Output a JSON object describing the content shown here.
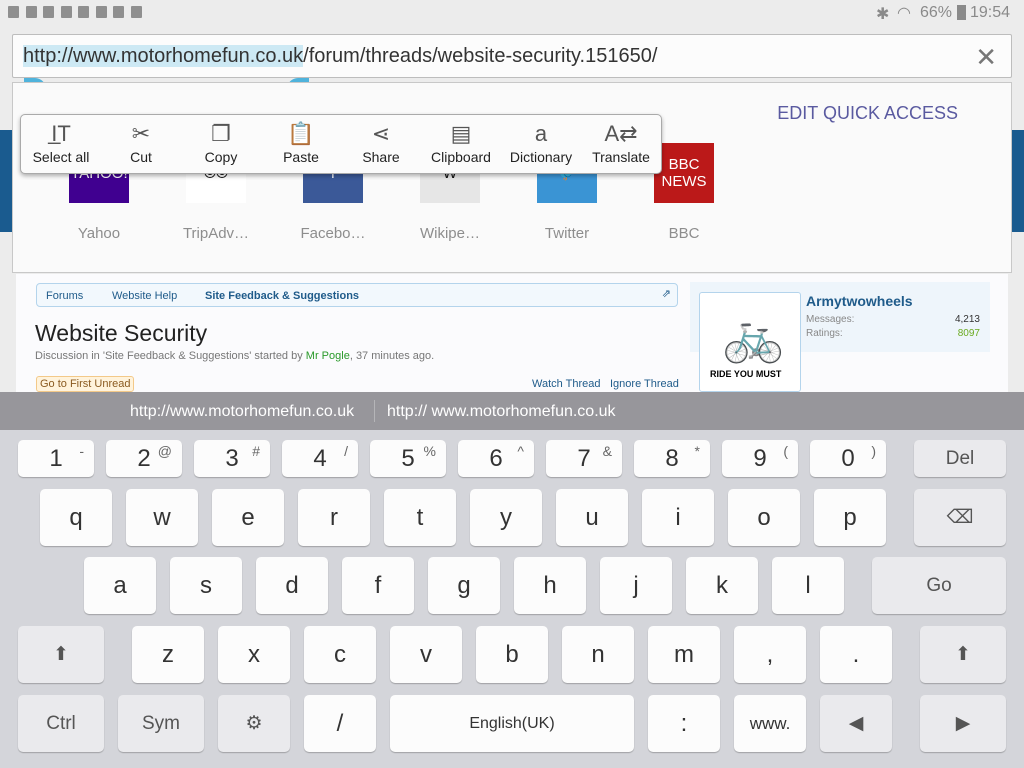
{
  "status": {
    "battery": "66%",
    "time": "19:54"
  },
  "urlbar": {
    "selected": "http://www.motorhomefun.co.uk",
    "rest": "/forum/threads/website-security.151650/"
  },
  "quick_access": {
    "edit": "EDIT QUICK ACCESS",
    "tiles": [
      {
        "label": "Yahoo",
        "color": "#400090",
        "glyph": "YAHOO!"
      },
      {
        "label": "TripAdv…",
        "color": "#ffffff",
        "glyph": "⦾⦾"
      },
      {
        "label": "Facebo…",
        "color": "#3b5998",
        "glyph": "f"
      },
      {
        "label": "Wikipe…",
        "color": "#e6e6e6",
        "glyph": "W"
      },
      {
        "label": "Twitter",
        "color": "#3a94d4",
        "glyph": "🐦"
      },
      {
        "label": "BBC",
        "color": "#bb1919",
        "glyph": "BBC NEWS"
      }
    ]
  },
  "context_menu": [
    {
      "label": "Select all",
      "icon": "select-all-icon",
      "glyph": "I̲T"
    },
    {
      "label": "Cut",
      "icon": "scissors-icon",
      "glyph": "✂"
    },
    {
      "label": "Copy",
      "icon": "copy-icon",
      "glyph": "❐"
    },
    {
      "label": "Paste",
      "icon": "paste-icon",
      "glyph": "📋"
    },
    {
      "label": "Share",
      "icon": "share-icon",
      "glyph": "⋖"
    },
    {
      "label": "Clipboard",
      "icon": "clipboard-icon",
      "glyph": "▤"
    },
    {
      "label": "Dictionary",
      "icon": "dictionary-icon",
      "glyph": "a"
    },
    {
      "label": "Translate",
      "icon": "translate-icon",
      "glyph": "A⇄"
    }
  ],
  "page": {
    "breadcrumbs": [
      "Forums",
      "Website Help",
      "Site Feedback & Suggestions"
    ],
    "title": "Website Security",
    "discussion_prefix": "Discussion in 'Site Feedback & Suggestions' started by ",
    "author": "Mr Pogle",
    "discussion_suffix": ", 37 minutes ago.",
    "first_unread": "Go to First Unread",
    "watch": "Watch Thread",
    "ignore": "Ignore Thread",
    "profile": {
      "name": "Armytwowheels",
      "messages_label": "Messages:",
      "messages": "4,213",
      "ratings_label": "Ratings:",
      "ratings": "8097",
      "avatar_caption": "RIDE YOU MUST"
    }
  },
  "suggestions": [
    "http://www.motorhomefun.co.uk",
    "http:// www.motorhomefun.co.uk"
  ],
  "keyboard": {
    "row1": [
      [
        "1",
        "-"
      ],
      [
        "2",
        "@"
      ],
      [
        "3",
        "#"
      ],
      [
        "4",
        "/"
      ],
      [
        "5",
        "%"
      ],
      [
        "6",
        "^"
      ],
      [
        "7",
        "&"
      ],
      [
        "8",
        "*"
      ],
      [
        "9",
        "("
      ],
      [
        "0",
        ")"
      ]
    ],
    "row2": [
      "q",
      "w",
      "e",
      "r",
      "t",
      "y",
      "u",
      "i",
      "o",
      "p"
    ],
    "row3": [
      "a",
      "s",
      "d",
      "f",
      "g",
      "h",
      "j",
      "k",
      "l"
    ],
    "row4": [
      "z",
      "x",
      "c",
      "v",
      "b",
      "n",
      "m",
      ",",
      "."
    ],
    "del": "Del",
    "go": "Go",
    "ctrl": "Ctrl",
    "sym": "Sym",
    "slash": "/",
    "space": "English(UK)",
    "colon": ":",
    "www": "www."
  }
}
